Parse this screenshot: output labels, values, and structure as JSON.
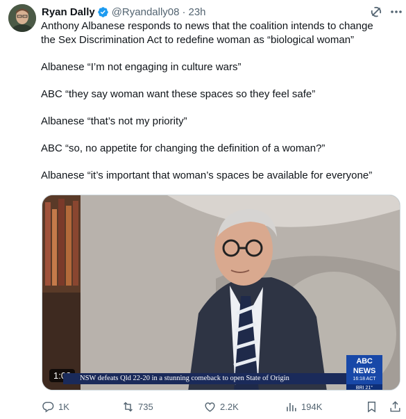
{
  "tweet": {
    "display_name": "Ryan Dally",
    "handle": "@Ryandally08",
    "separator": "·",
    "time": "23h",
    "lines": [
      "Anthony Albanese responds to news that the coalition intends to change",
      "the Sex Discrimination Act to redefine woman as “biological woman”",
      "Albanese “I’m not engaging in culture wars”",
      "ABC “they say woman want these spaces so they feel safe”",
      "Albanese “that’s not my priority”",
      "ABC “so, no appetite for changing the definition of a woman?”",
      "Albanese “it’s important that woman’s spaces be available for everyone”"
    ]
  },
  "media": {
    "duration": "1:02",
    "ticker": "NSW defeats Qld 22-20 in a stunning comeback to open State of Origin",
    "news_logo": "ABC NEWS",
    "news_time": "16:18 ACT",
    "news_weather": "BRI 21°"
  },
  "actions": {
    "replies": "1K",
    "reposts": "735",
    "likes": "2.2K",
    "views": "194K"
  },
  "colors": {
    "verified": "#1d9bf0",
    "secondary_text": "#536471",
    "abc_blue": "#1848a8"
  },
  "icons": [
    "verified-badge-icon",
    "grok-icon",
    "more-icon",
    "reply-icon",
    "repost-icon",
    "like-icon",
    "views-icon",
    "bookmark-icon"
  ]
}
